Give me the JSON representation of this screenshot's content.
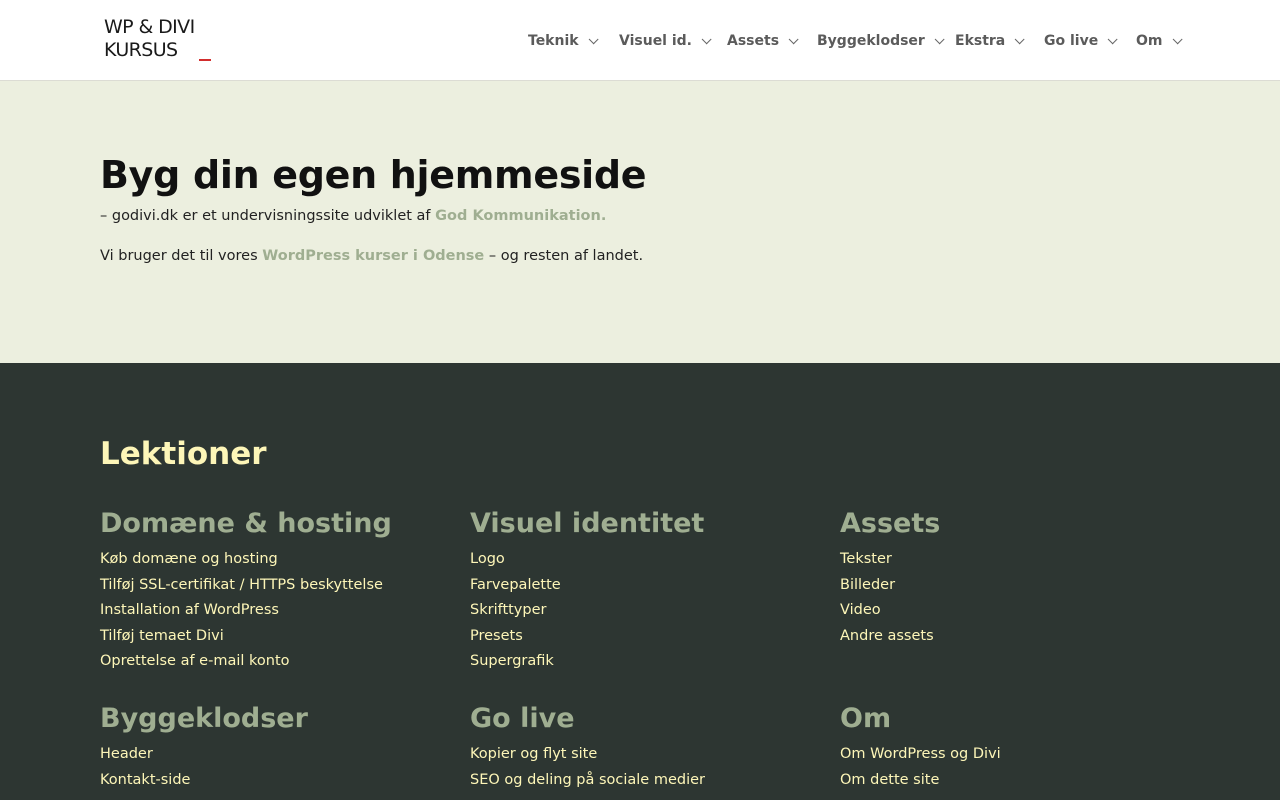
{
  "logo": {
    "line1": "WP & DIVI",
    "line2": "KURSUS"
  },
  "colors": {
    "accent": "#9fae91",
    "footer_bg": "#2d3632",
    "footer_text": "#fdf6b8",
    "page_bg": "#ecefdf",
    "logo_dash": "#d22d2d"
  },
  "nav": [
    "Teknik",
    "Visuel id.",
    "Assets",
    "Byggeklodser",
    "Ekstra",
    "Go live",
    "Om"
  ],
  "hero": {
    "title": "Byg din egen hjemmeside",
    "p1_text": "– godivi.dk er et undervisningssite udviklet af",
    "p1_link": "God Kommunikation.",
    "p2_pre": "Vi bruger det til vores",
    "p2_link": "WordPress kurser i Odense",
    "p2_post": "– og resten af landet."
  },
  "footer": {
    "title": "Lektioner",
    "columns": [
      {
        "heading": "Domæne & hosting",
        "items": [
          "Køb domæne og hosting",
          "Tilføj SSL-certifikat / HTTPS beskyttelse",
          "Installation af WordPress",
          "Tilføj temaet Divi",
          "Oprettelse af e-mail konto"
        ]
      },
      {
        "heading": "Visuel identitet",
        "items": [
          "Logo",
          "Farvepalette",
          "Skrifttyper",
          "Presets",
          "Supergrafik"
        ]
      },
      {
        "heading": "Assets",
        "items": [
          "Tekster",
          "Billeder",
          "Video",
          "Andre assets"
        ]
      },
      {
        "heading": "Byggeklodser",
        "items": [
          "Header",
          "Kontakt-side"
        ]
      },
      {
        "heading": "Go live",
        "items": [
          "Kopier og flyt site",
          "SEO og deling på sociale medier"
        ]
      },
      {
        "heading": "Om",
        "items": [
          "Om WordPress og Divi",
          "Om dette site"
        ]
      }
    ]
  }
}
